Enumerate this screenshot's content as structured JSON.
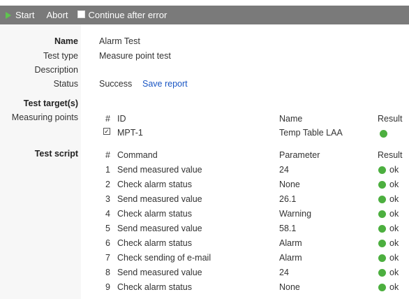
{
  "toolbar": {
    "start_label": "Start",
    "abort_label": "Abort",
    "continue_label": "Continue after error"
  },
  "details": {
    "name_label": "Name",
    "name_value": "Alarm Test",
    "type_label": "Test type",
    "type_value": "Measure point test",
    "description_label": "Description",
    "description_value": "",
    "status_label": "Status",
    "status_value": "Success",
    "save_report_label": "Save report"
  },
  "targets": {
    "section_label": "Test target(s)",
    "measuring_points_label": "Measuring points",
    "headers": {
      "num": "#",
      "id": "ID",
      "name": "Name",
      "result": "Result"
    },
    "rows": [
      {
        "checked": true,
        "id": "MPT-1",
        "name": "Temp Table LAA",
        "result_color": "#4caf3f"
      }
    ]
  },
  "script": {
    "section_label": "Test script",
    "headers": {
      "num": "#",
      "command": "Command",
      "parameter": "Parameter",
      "result": "Result"
    },
    "rows": [
      {
        "num": "1",
        "command": "Send measured value",
        "parameter": "24",
        "result": "ok"
      },
      {
        "num": "2",
        "command": "Check alarm status",
        "parameter": "None",
        "result": "ok"
      },
      {
        "num": "3",
        "command": "Send measured value",
        "parameter": "26.1",
        "result": "ok"
      },
      {
        "num": "4",
        "command": "Check alarm status",
        "parameter": "Warning",
        "result": "ok"
      },
      {
        "num": "5",
        "command": "Send measured value",
        "parameter": "58.1",
        "result": "ok"
      },
      {
        "num": "6",
        "command": "Check alarm status",
        "parameter": "Alarm",
        "result": "ok"
      },
      {
        "num": "7",
        "command": "Check sending of e-mail",
        "parameter": "Alarm",
        "result": "ok"
      },
      {
        "num": "8",
        "command": "Send measured value",
        "parameter": "24",
        "result": "ok"
      },
      {
        "num": "9",
        "command": "Check alarm status",
        "parameter": "None",
        "result": "ok"
      }
    ]
  },
  "colors": {
    "toolbar_bg": "#7a7a7a",
    "play_green": "#5fc44f",
    "status_green": "#4caf3f",
    "link_blue": "#1a56c4"
  }
}
